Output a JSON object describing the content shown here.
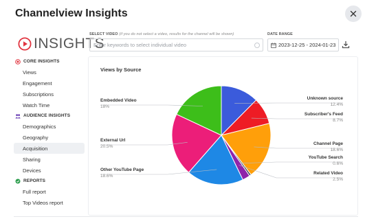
{
  "modal": {
    "title": "Channelview Insights"
  },
  "brand": {
    "text": "INSIGHTS"
  },
  "filters": {
    "video_label": "SELECT VIDEO",
    "video_hint": "(if you do not select a video, results for the channel will be shown)",
    "search_placeholder": "Enter keywords to select individual video",
    "date_label": "DATE RANGE",
    "date_value": "2023-12-25 - 2024-01-23"
  },
  "sidebar": {
    "sections": [
      {
        "title": "CORE INSIGHTS",
        "icon": "target-icon",
        "items": [
          "Views",
          "Engagement",
          "Subscriptions",
          "Watch Time"
        ]
      },
      {
        "title": "AUDIENCE INSIGHTS",
        "icon": "audience-icon",
        "items": [
          "Demographics",
          "Geography",
          "Acquisition",
          "Sharing",
          "Devices"
        ]
      },
      {
        "title": "REPORTS",
        "icon": "reports-icon",
        "items": [
          "Full report",
          "Top Videos report"
        ]
      }
    ],
    "active_item": "Acquisition"
  },
  "chart_data": {
    "type": "pie",
    "title": "Views by Source",
    "slices": [
      {
        "label": "Unknown source",
        "value": 12.4,
        "value_label": "12.4%",
        "color": "#3B5BDB"
      },
      {
        "label": "Subscriber's Feed",
        "value": 8.7,
        "value_label": "8.7%",
        "color": "#EE1C25"
      },
      {
        "label": "Channel Page",
        "value": 18.6,
        "value_label": "18.6%",
        "color": "#FF9F0A"
      },
      {
        "label": "YouTube Search",
        "value": 0.6,
        "value_label": "0.6%",
        "color": "#3E4756"
      },
      {
        "label": "Related Video",
        "value": 2.5,
        "value_label": "2.5%",
        "color": "#8E24AA"
      },
      {
        "label": "Other YouTube Page",
        "value": 18.6,
        "value_label": "18.6%",
        "color": "#1E88E5"
      },
      {
        "label": "External Url",
        "value": 20.5,
        "value_label": "20.5%",
        "color": "#EC1E79"
      },
      {
        "label": "Embedded Video",
        "value": 18,
        "value_label": "18%",
        "color": "#3DBE1A"
      }
    ]
  }
}
